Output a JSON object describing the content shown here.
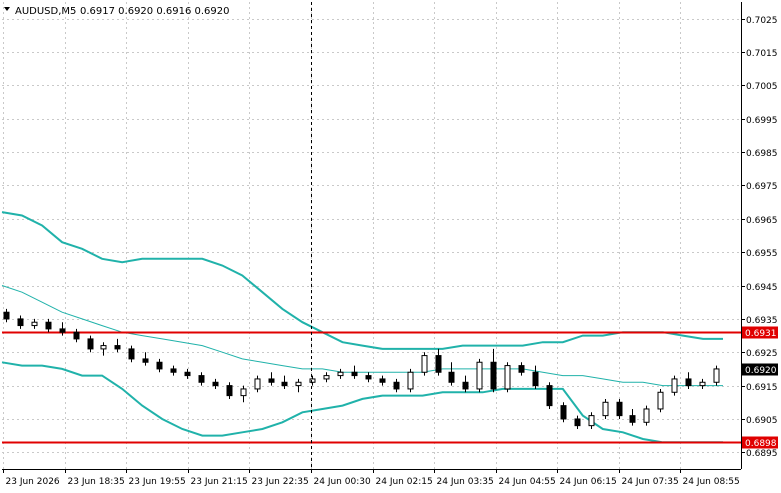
{
  "header": {
    "symbol_timeframe": "AUDUSD,M5",
    "ohlc": "0.6917 0.6920 0.6916 0.6920",
    "menu_icon": "triangle-down-icon"
  },
  "colors": {
    "background": "#ffffff",
    "grid": "#c9c9c9",
    "axis": "#000000",
    "bollinger": "#20b2aa",
    "level_line": "#e00000",
    "level_label_bg": "#e00000",
    "level_label_text": "#ffffff",
    "price_label_bg": "#000000",
    "price_label_text": "#ffffff",
    "bull_candle": "#ffffff",
    "bear_candle": "#000000"
  },
  "chart_data": {
    "type": "candlestick",
    "symbol": "AUDUSD",
    "timeframe": "M5",
    "y_ticks": [
      "0.7025",
      "0.7015",
      "0.7005",
      "0.6995",
      "0.6985",
      "0.6975",
      "0.6965",
      "0.6955",
      "0.6945",
      "0.6935",
      "0.6925",
      "0.6915",
      "0.6905",
      "0.6895"
    ],
    "ylim": [
      0.689,
      0.703
    ],
    "grid": true,
    "x_tick_labels": [
      "23 Jun 2026",
      "23 Jun 18:35",
      "23 Jun 19:55",
      "23 Jun 21:15",
      "23 Jun 22:35",
      "24 Jun 00:30",
      "24 Jun 02:15",
      "24 Jun 03:35",
      "24 Jun 04:55",
      "24 Jun 06:15",
      "24 Jun 07:35",
      "24 Jun 08:55"
    ],
    "current_price": "0.6920",
    "horizontal_levels": [
      {
        "label": "0.6931",
        "value": 0.6931
      },
      {
        "label": "0.6898",
        "value": 0.6898
      }
    ],
    "session_divider_index": 38,
    "bollinger_upper": [
      0.6967,
      0.6966,
      0.6963,
      0.6958,
      0.6956,
      0.6953,
      0.6952,
      0.6953,
      0.6953,
      0.6953,
      0.6953,
      0.6951,
      0.6948,
      0.6943,
      0.6938,
      0.6934,
      0.6931,
      0.6928,
      0.6927,
      0.6926,
      0.6926,
      0.6926,
      0.6926,
      0.6927,
      0.6927,
      0.6927,
      0.6927,
      0.6928,
      0.6928,
      0.693,
      0.693,
      0.6931,
      0.6931,
      0.6931,
      0.693,
      0.6929,
      0.6929
    ],
    "bollinger_middle": [
      0.6945,
      0.6943,
      0.694,
      0.6937,
      0.6935,
      0.6933,
      0.6931,
      0.693,
      0.6929,
      0.6928,
      0.6927,
      0.6925,
      0.6923,
      0.6922,
      0.6921,
      0.692,
      0.692,
      0.6919,
      0.6919,
      0.6919,
      0.6919,
      0.6919,
      0.692,
      0.692,
      0.692,
      0.692,
      0.692,
      0.6919,
      0.6918,
      0.6918,
      0.6917,
      0.6916,
      0.6916,
      0.6915,
      0.6915,
      0.6915,
      0.6915
    ],
    "bollinger_lower": [
      0.6922,
      0.6921,
      0.6921,
      0.692,
      0.6918,
      0.6918,
      0.6914,
      0.6909,
      0.6905,
      0.6902,
      0.69,
      0.69,
      0.6901,
      0.6902,
      0.6904,
      0.6907,
      0.6908,
      0.6909,
      0.6911,
      0.6912,
      0.6912,
      0.6912,
      0.6913,
      0.6913,
      0.6913,
      0.6914,
      0.6914,
      0.6914,
      0.6914,
      0.6906,
      0.6902,
      0.6901,
      0.6899,
      0.6898,
      0.6898,
      0.6898,
      0.6898
    ],
    "candles": [
      {
        "o": 0.6937,
        "h": 0.6938,
        "l": 0.6934,
        "c": 0.6935
      },
      {
        "o": 0.6935,
        "h": 0.6936,
        "l": 0.6932,
        "c": 0.6933
      },
      {
        "o": 0.6933,
        "h": 0.6935,
        "l": 0.6932,
        "c": 0.6934
      },
      {
        "o": 0.6934,
        "h": 0.6935,
        "l": 0.6931,
        "c": 0.6932
      },
      {
        "o": 0.6932,
        "h": 0.6934,
        "l": 0.693,
        "c": 0.6931
      },
      {
        "o": 0.6931,
        "h": 0.6932,
        "l": 0.6928,
        "c": 0.6929
      },
      {
        "o": 0.6929,
        "h": 0.693,
        "l": 0.6925,
        "c": 0.6926
      },
      {
        "o": 0.6926,
        "h": 0.6928,
        "l": 0.6924,
        "c": 0.6927
      },
      {
        "o": 0.6927,
        "h": 0.6929,
        "l": 0.6925,
        "c": 0.6926
      },
      {
        "o": 0.6926,
        "h": 0.6927,
        "l": 0.6922,
        "c": 0.6923
      },
      {
        "o": 0.6923,
        "h": 0.6925,
        "l": 0.6921,
        "c": 0.6922
      },
      {
        "o": 0.6922,
        "h": 0.6923,
        "l": 0.6919,
        "c": 0.692
      },
      {
        "o": 0.692,
        "h": 0.6921,
        "l": 0.6918,
        "c": 0.6919
      },
      {
        "o": 0.6919,
        "h": 0.692,
        "l": 0.6917,
        "c": 0.6918
      },
      {
        "o": 0.6918,
        "h": 0.6919,
        "l": 0.6915,
        "c": 0.6916
      },
      {
        "o": 0.6916,
        "h": 0.6917,
        "l": 0.6914,
        "c": 0.6915
      },
      {
        "o": 0.6915,
        "h": 0.6916,
        "l": 0.6911,
        "c": 0.6912
      },
      {
        "o": 0.6912,
        "h": 0.6915,
        "l": 0.691,
        "c": 0.6914
      },
      {
        "o": 0.6914,
        "h": 0.6918,
        "l": 0.6913,
        "c": 0.6917
      },
      {
        "o": 0.6917,
        "h": 0.6919,
        "l": 0.6915,
        "c": 0.6916
      },
      {
        "o": 0.6916,
        "h": 0.6918,
        "l": 0.6914,
        "c": 0.6915
      },
      {
        "o": 0.6915,
        "h": 0.6917,
        "l": 0.6913,
        "c": 0.6916
      },
      {
        "o": 0.6916,
        "h": 0.6918,
        "l": 0.6915,
        "c": 0.6917
      },
      {
        "o": 0.6917,
        "h": 0.6919,
        "l": 0.6916,
        "c": 0.6918
      },
      {
        "o": 0.6918,
        "h": 0.692,
        "l": 0.6917,
        "c": 0.6919
      },
      {
        "o": 0.6919,
        "h": 0.6921,
        "l": 0.6917,
        "c": 0.6918
      },
      {
        "o": 0.6918,
        "h": 0.6919,
        "l": 0.6916,
        "c": 0.6917
      },
      {
        "o": 0.6917,
        "h": 0.6918,
        "l": 0.6915,
        "c": 0.6916
      },
      {
        "o": 0.6916,
        "h": 0.6917,
        "l": 0.6913,
        "c": 0.6914
      },
      {
        "o": 0.6914,
        "h": 0.692,
        "l": 0.6913,
        "c": 0.6919
      },
      {
        "o": 0.6919,
        "h": 0.6925,
        "l": 0.6918,
        "c": 0.6924
      },
      {
        "o": 0.6924,
        "h": 0.6926,
        "l": 0.6918,
        "c": 0.6919
      },
      {
        "o": 0.6919,
        "h": 0.6922,
        "l": 0.6915,
        "c": 0.6916
      },
      {
        "o": 0.6916,
        "h": 0.6918,
        "l": 0.6913,
        "c": 0.6914
      },
      {
        "o": 0.6914,
        "h": 0.6923,
        "l": 0.6913,
        "c": 0.6922
      },
      {
        "o": 0.6922,
        "h": 0.6926,
        "l": 0.6913,
        "c": 0.6914
      },
      {
        "o": 0.6914,
        "h": 0.6922,
        "l": 0.6913,
        "c": 0.6921
      },
      {
        "o": 0.6921,
        "h": 0.6922,
        "l": 0.6918,
        "c": 0.6919
      },
      {
        "o": 0.6919,
        "h": 0.6921,
        "l": 0.6914,
        "c": 0.6915
      },
      {
        "o": 0.6915,
        "h": 0.6916,
        "l": 0.6908,
        "c": 0.6909
      },
      {
        "o": 0.6909,
        "h": 0.691,
        "l": 0.6904,
        "c": 0.6905
      },
      {
        "o": 0.6905,
        "h": 0.6906,
        "l": 0.6902,
        "c": 0.6903
      },
      {
        "o": 0.6903,
        "h": 0.6907,
        "l": 0.6902,
        "c": 0.6906
      },
      {
        "o": 0.6906,
        "h": 0.6911,
        "l": 0.6905,
        "c": 0.691
      },
      {
        "o": 0.691,
        "h": 0.6911,
        "l": 0.6905,
        "c": 0.6906
      },
      {
        "o": 0.6906,
        "h": 0.6908,
        "l": 0.6903,
        "c": 0.6904
      },
      {
        "o": 0.6904,
        "h": 0.6909,
        "l": 0.6903,
        "c": 0.6908
      },
      {
        "o": 0.6908,
        "h": 0.6914,
        "l": 0.6907,
        "c": 0.6913
      },
      {
        "o": 0.6913,
        "h": 0.6918,
        "l": 0.6912,
        "c": 0.6917
      },
      {
        "o": 0.6917,
        "h": 0.6919,
        "l": 0.6914,
        "c": 0.6915
      },
      {
        "o": 0.6915,
        "h": 0.6917,
        "l": 0.6914,
        "c": 0.6916
      },
      {
        "o": 0.6916,
        "h": 0.6921,
        "l": 0.6915,
        "c": 0.692
      }
    ]
  }
}
